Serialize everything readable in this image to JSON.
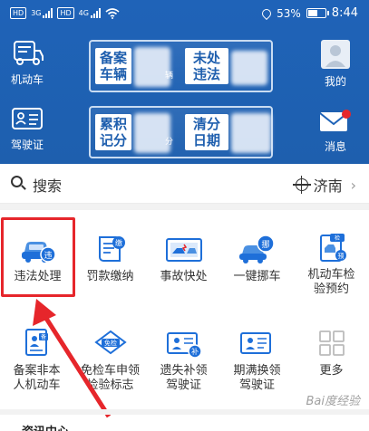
{
  "status_bar": {
    "hd1": "HD",
    "net1": "3G",
    "hd2": "HD",
    "net2": "4G",
    "battery": "53%",
    "time": "8:44"
  },
  "header": {
    "motor_vehicle": "机动车",
    "license": "驾驶证",
    "mine": "我的",
    "messages": "消息",
    "card1": {
      "left": "备案\n车辆",
      "unit": "辆",
      "right": "未处\n违法"
    },
    "card2": {
      "left": "累积\n记分",
      "unit": "分",
      "right": "清分\n日期"
    }
  },
  "search": {
    "label": "搜索",
    "city": "济南"
  },
  "services": [
    {
      "label": "违法处理"
    },
    {
      "label": "罚款缴纳"
    },
    {
      "label": "事故快处"
    },
    {
      "label": "一键挪车"
    },
    {
      "label": "机动车检\n验预约"
    },
    {
      "label": "备案非本\n人机动车"
    },
    {
      "label": "免检车申领\n检验标志"
    },
    {
      "label": "遗失补领\n驾驶证"
    },
    {
      "label": "期满换领\n驾驶证"
    },
    {
      "label": "更多"
    }
  ],
  "badges": {
    "violation": "违",
    "fine": "缴",
    "move": "挪",
    "inspect": "检",
    "reserve": "预",
    "exempt": "免检",
    "reissue": "补",
    "record": "备"
  },
  "bottom": {
    "section_title": "资讯中心"
  },
  "watermark": "Bai度经验",
  "colors": {
    "header_blue": "#1f63b8",
    "accent_blue": "#1e6fd9",
    "highlight_red": "#e6262b"
  }
}
